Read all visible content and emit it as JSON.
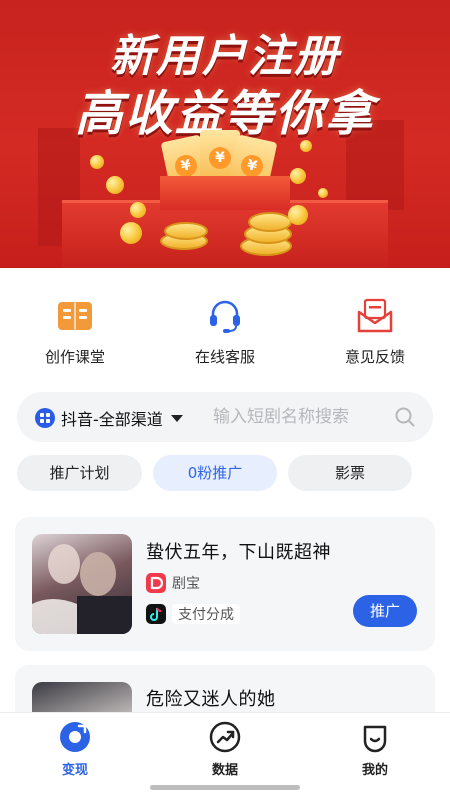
{
  "banner": {
    "line1": "新用户注册",
    "line2": "高收益等你拿",
    "currency_symbol": "¥",
    "brand_color": "#d42a24"
  },
  "quick_actions": [
    {
      "label": "创作课堂",
      "icon": "book-icon"
    },
    {
      "label": "在线客服",
      "icon": "headset-icon"
    },
    {
      "label": "意见反馈",
      "icon": "mail-icon"
    }
  ],
  "search": {
    "channel_label": "抖音-全部渠道",
    "placeholder": "输入短剧名称搜索"
  },
  "filter_tabs": [
    {
      "label": "推广计划",
      "selected": false
    },
    {
      "label": "0粉推广",
      "selected": true
    },
    {
      "label": "影票",
      "selected": false
    }
  ],
  "dramas": [
    {
      "title": "蛰伏五年，下山既超神",
      "platform": "剧宝",
      "platform_icon": "jubao-logo-icon",
      "payment": "支付分成",
      "payment_icon": "douyin-logo-icon",
      "action_label": "推广"
    },
    {
      "title": "危险又迷人的她"
    }
  ],
  "bottom_nav": [
    {
      "label": "变现",
      "icon": "monetize-icon",
      "active": true
    },
    {
      "label": "数据",
      "icon": "trend-icon",
      "active": false
    },
    {
      "label": "我的",
      "icon": "profile-icon",
      "active": false
    }
  ],
  "colors": {
    "accent": "#2c63e6",
    "tab_selected_bg": "#e7efff",
    "feedback_red": "#e5403a",
    "course_orange": "#f29a3a"
  }
}
